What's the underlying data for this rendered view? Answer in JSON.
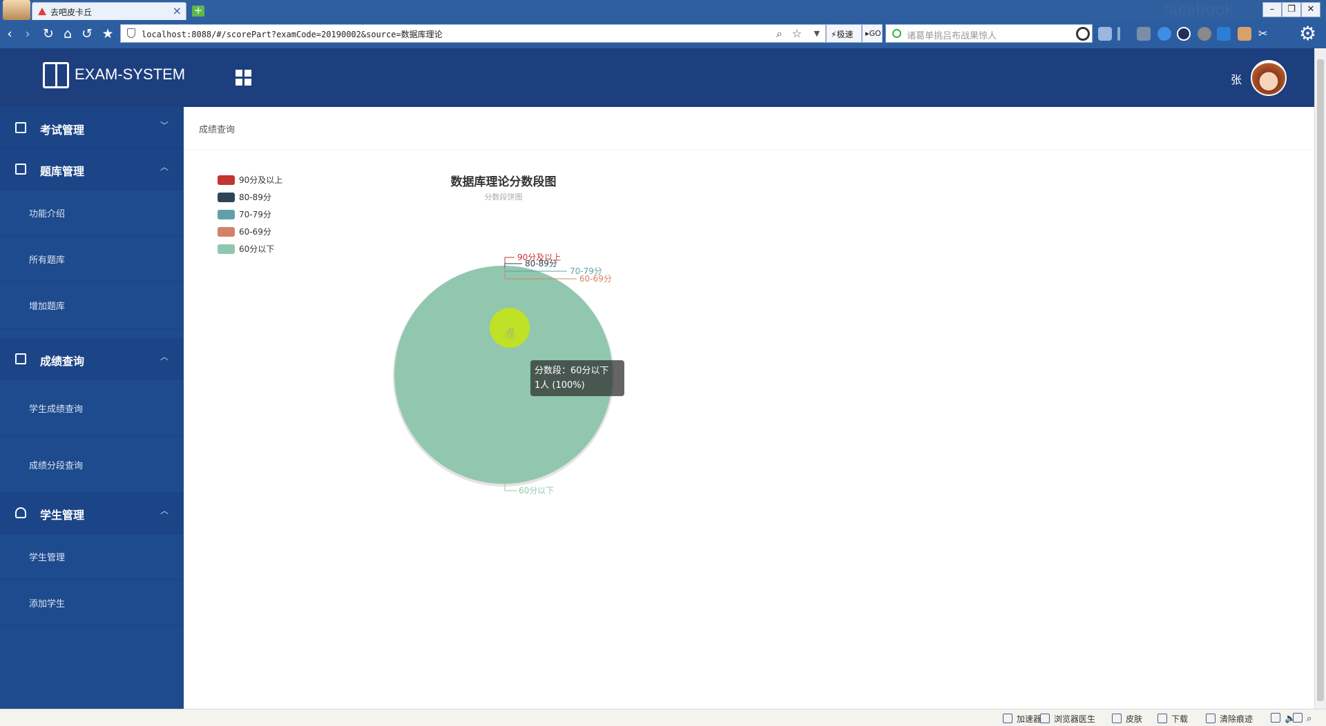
{
  "browser": {
    "tab_title": "去吧皮卡丘",
    "url": "localhost:8088/#/scorePart?examCode=20190002&source=数据库理论",
    "speed_mode_label": "极速",
    "go_label": "GO",
    "search_placeholder": "诸葛单挑吕布战果惊人",
    "watermark_text": "facebook"
  },
  "header": {
    "brand": "EXAM-SYSTEM",
    "user_name": "张"
  },
  "sidebar": {
    "groups": [
      {
        "label": "考试管理",
        "icon": "list-icon",
        "caret": "chevron-down-icon",
        "items": []
      },
      {
        "label": "题库管理",
        "icon": "document-icon",
        "caret": "chevron-up-icon",
        "items": [
          "功能介绍",
          "所有题库",
          "增加题库"
        ]
      },
      {
        "label": "成绩查询",
        "icon": "keyboard-icon",
        "caret": "chevron-up-icon",
        "items": [
          "学生成绩查询",
          "成绩分段查询"
        ]
      },
      {
        "label": "学生管理",
        "icon": "user-icon",
        "caret": "chevron-up-icon",
        "items": [
          "学生管理",
          "添加学生"
        ]
      }
    ]
  },
  "main": {
    "breadcrumb": "成绩查询"
  },
  "chart_data": {
    "type": "pie",
    "title": "数据库理论分数段图",
    "subtitle": "分数段饼图",
    "legend_position": "top-left",
    "categories": [
      "90分及以上",
      "80-89分",
      "70-79分",
      "60-69分",
      "60分以下"
    ],
    "values": [
      0,
      0,
      0,
      0,
      1
    ],
    "colors": [
      "#c23531",
      "#2f4554",
      "#61a0a8",
      "#d48265",
      "#91c7ae"
    ],
    "unit": "人"
  },
  "tooltip": {
    "line1": "分数段：60分以下",
    "line2": "1人 (100%)"
  },
  "statusbar": {
    "items": [
      "加速器",
      "浏览器医生",
      "皮肤",
      "下载",
      "清除痕迹"
    ]
  }
}
